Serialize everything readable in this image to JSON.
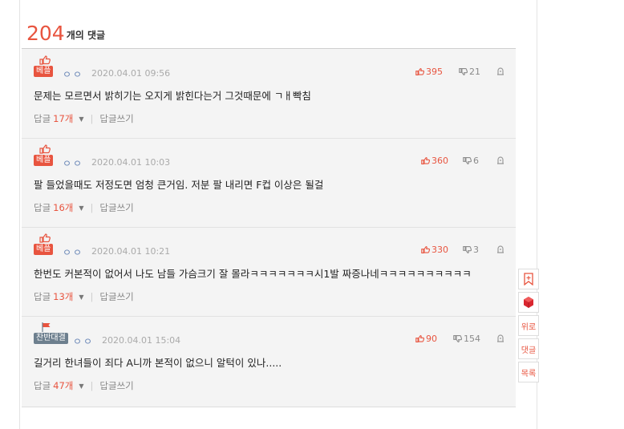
{
  "header": {
    "count": "204",
    "label": "개의 댓글"
  },
  "colors": {
    "accent": "#e8543f",
    "user": "#6b88b8"
  },
  "comments": [
    {
      "badge": "베플",
      "badge_type": "best",
      "user": "ㅇㅇ",
      "time": "2020.04.01 09:56",
      "text": "문제는 모르면서 밝히기는 오지게 밝힌다는거 그것때문에 ㄱㅐ빡침",
      "up": "395",
      "down": "21",
      "reply_label": "답글",
      "reply_count": "17개",
      "write_reply": "답글쓰기"
    },
    {
      "badge": "베플",
      "badge_type": "best",
      "user": "ㅇㅇ",
      "time": "2020.04.01 10:03",
      "text": "팔 들었을때도 저정도면 엄청 큰거임. 저분 팔 내리면 F컵 이상은 될걸",
      "up": "360",
      "down": "6",
      "reply_label": "답글",
      "reply_count": "16개",
      "write_reply": "답글쓰기"
    },
    {
      "badge": "베플",
      "badge_type": "best",
      "user": "ㅇㅇ",
      "time": "2020.04.01 10:21",
      "text": "한번도 커본적이 없어서 나도 남들 가슴크기 잘 몰라ㅋㅋㅋㅋㅋㅋㅋ시1발 짜증나네ㅋㅋㅋㅋㅋㅋㅋㅋㅋㅋ",
      "up": "330",
      "down": "3",
      "reply_label": "답글",
      "reply_count": "13개",
      "write_reply": "답글쓰기"
    },
    {
      "badge": "찬반대결",
      "badge_type": "versus",
      "user": "ㅇㅇ",
      "time": "2020.04.01 15:04",
      "text": "길거리 한녀들이 죄다 A니까 본적이 없으니 알턱이 있나.....",
      "up": "90",
      "down": "154",
      "reply_label": "답글",
      "reply_count": "47개",
      "write_reply": "답글쓰기"
    }
  ],
  "side_nav": [
    {
      "name": "bookmark",
      "label": ""
    },
    {
      "name": "cube",
      "label": ""
    },
    {
      "name": "top",
      "label": "위로"
    },
    {
      "name": "comments",
      "label": "댓글"
    },
    {
      "name": "list",
      "label": "목록"
    }
  ]
}
